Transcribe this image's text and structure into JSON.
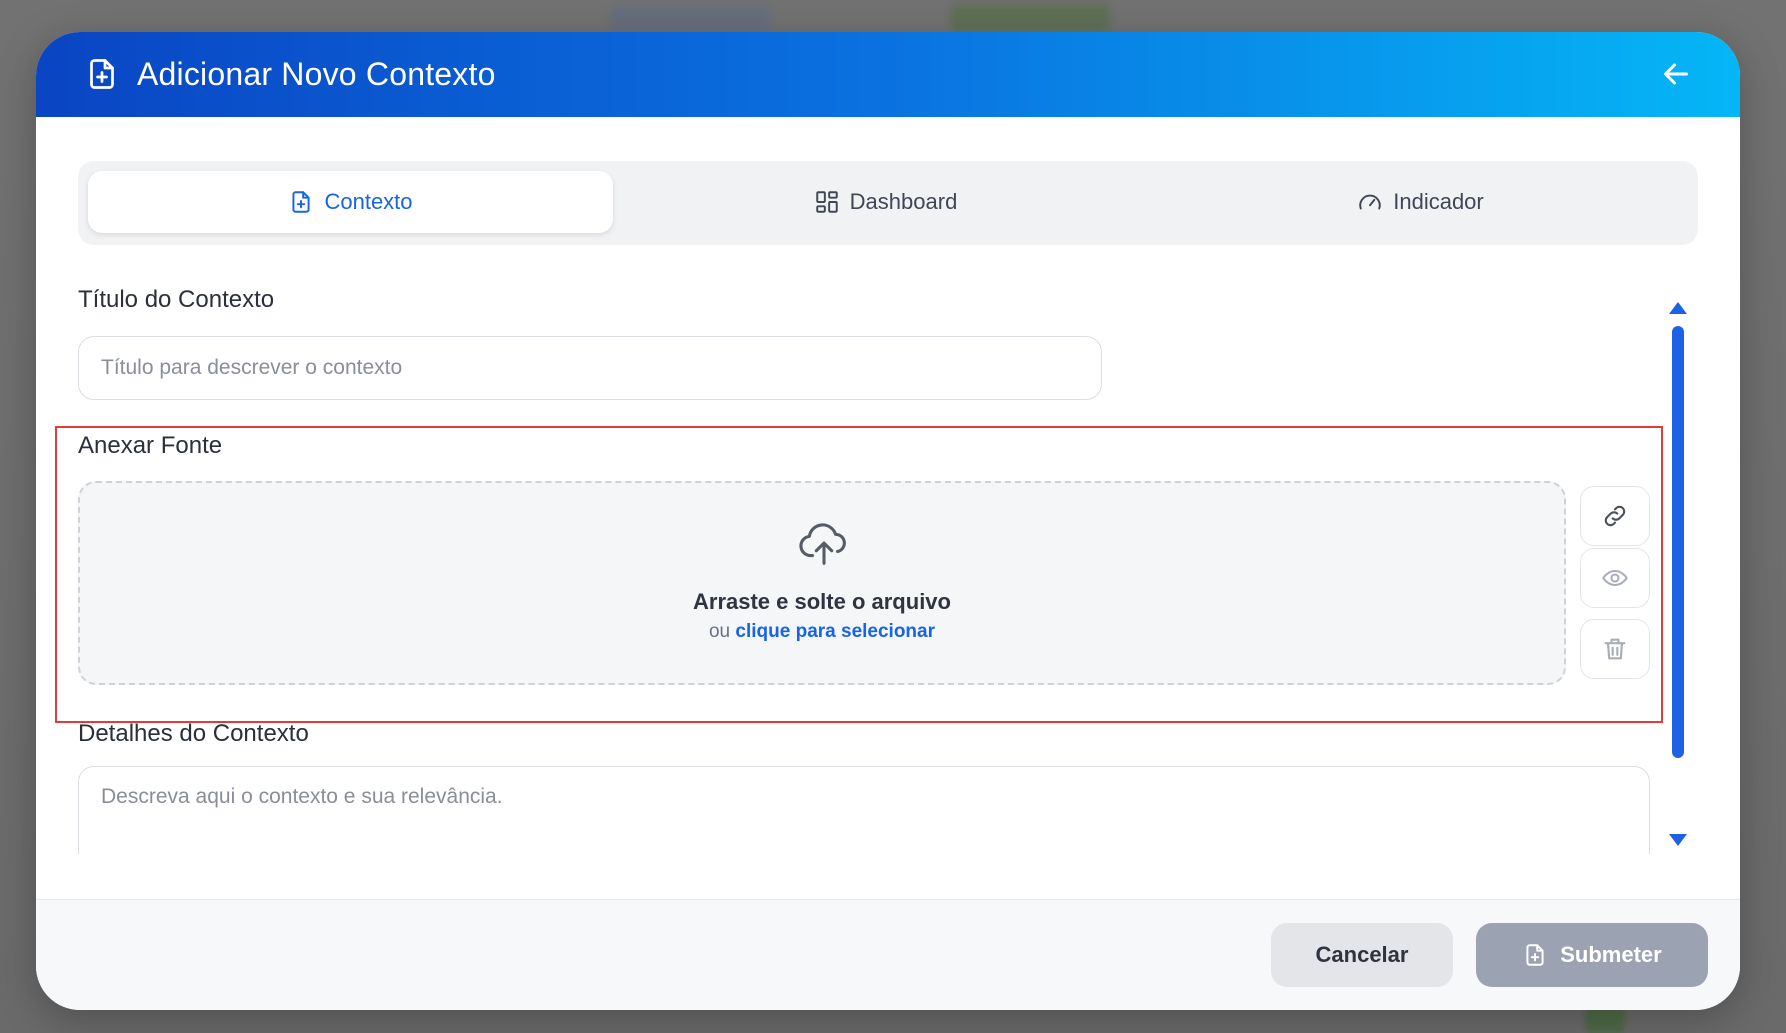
{
  "modal": {
    "title": "Adicionar Novo Contexto",
    "header_icon": "file-plus-icon",
    "back_icon": "arrow-left-icon"
  },
  "tabs": [
    {
      "label": "Contexto",
      "icon": "file-plus-icon",
      "active": true
    },
    {
      "label": "Dashboard",
      "icon": "grid-icon",
      "active": false
    },
    {
      "label": "Indicador",
      "icon": "gauge-icon",
      "active": false
    }
  ],
  "form": {
    "title_label": "Título do Contexto",
    "title_placeholder": "Título para descrever o contexto",
    "title_value": "",
    "attach_label": "Anexar Fonte",
    "dropzone": {
      "main_text": "Arraste e solte o arquivo",
      "sub_prefix": "ou",
      "sub_link": "clique para selecionar",
      "icon": "cloud-upload-icon"
    },
    "side_actions": [
      {
        "icon": "link-icon",
        "enabled": true
      },
      {
        "icon": "eye-icon",
        "enabled": false
      },
      {
        "icon": "trash-icon",
        "enabled": false
      }
    ],
    "details_label": "Detalhes do Contexto",
    "details_placeholder": "Descreva aqui o contexto e sua relevância.",
    "details_value": ""
  },
  "footer": {
    "cancel_label": "Cancelar",
    "submit_label": "Submeter",
    "submit_icon": "file-plus-icon"
  },
  "colors": {
    "header_start": "#0a45c3",
    "header_end": "#05b6f6",
    "accent": "#1764e6",
    "highlight": "#e43a3a",
    "submit_disabled": "#9ba3b3"
  }
}
